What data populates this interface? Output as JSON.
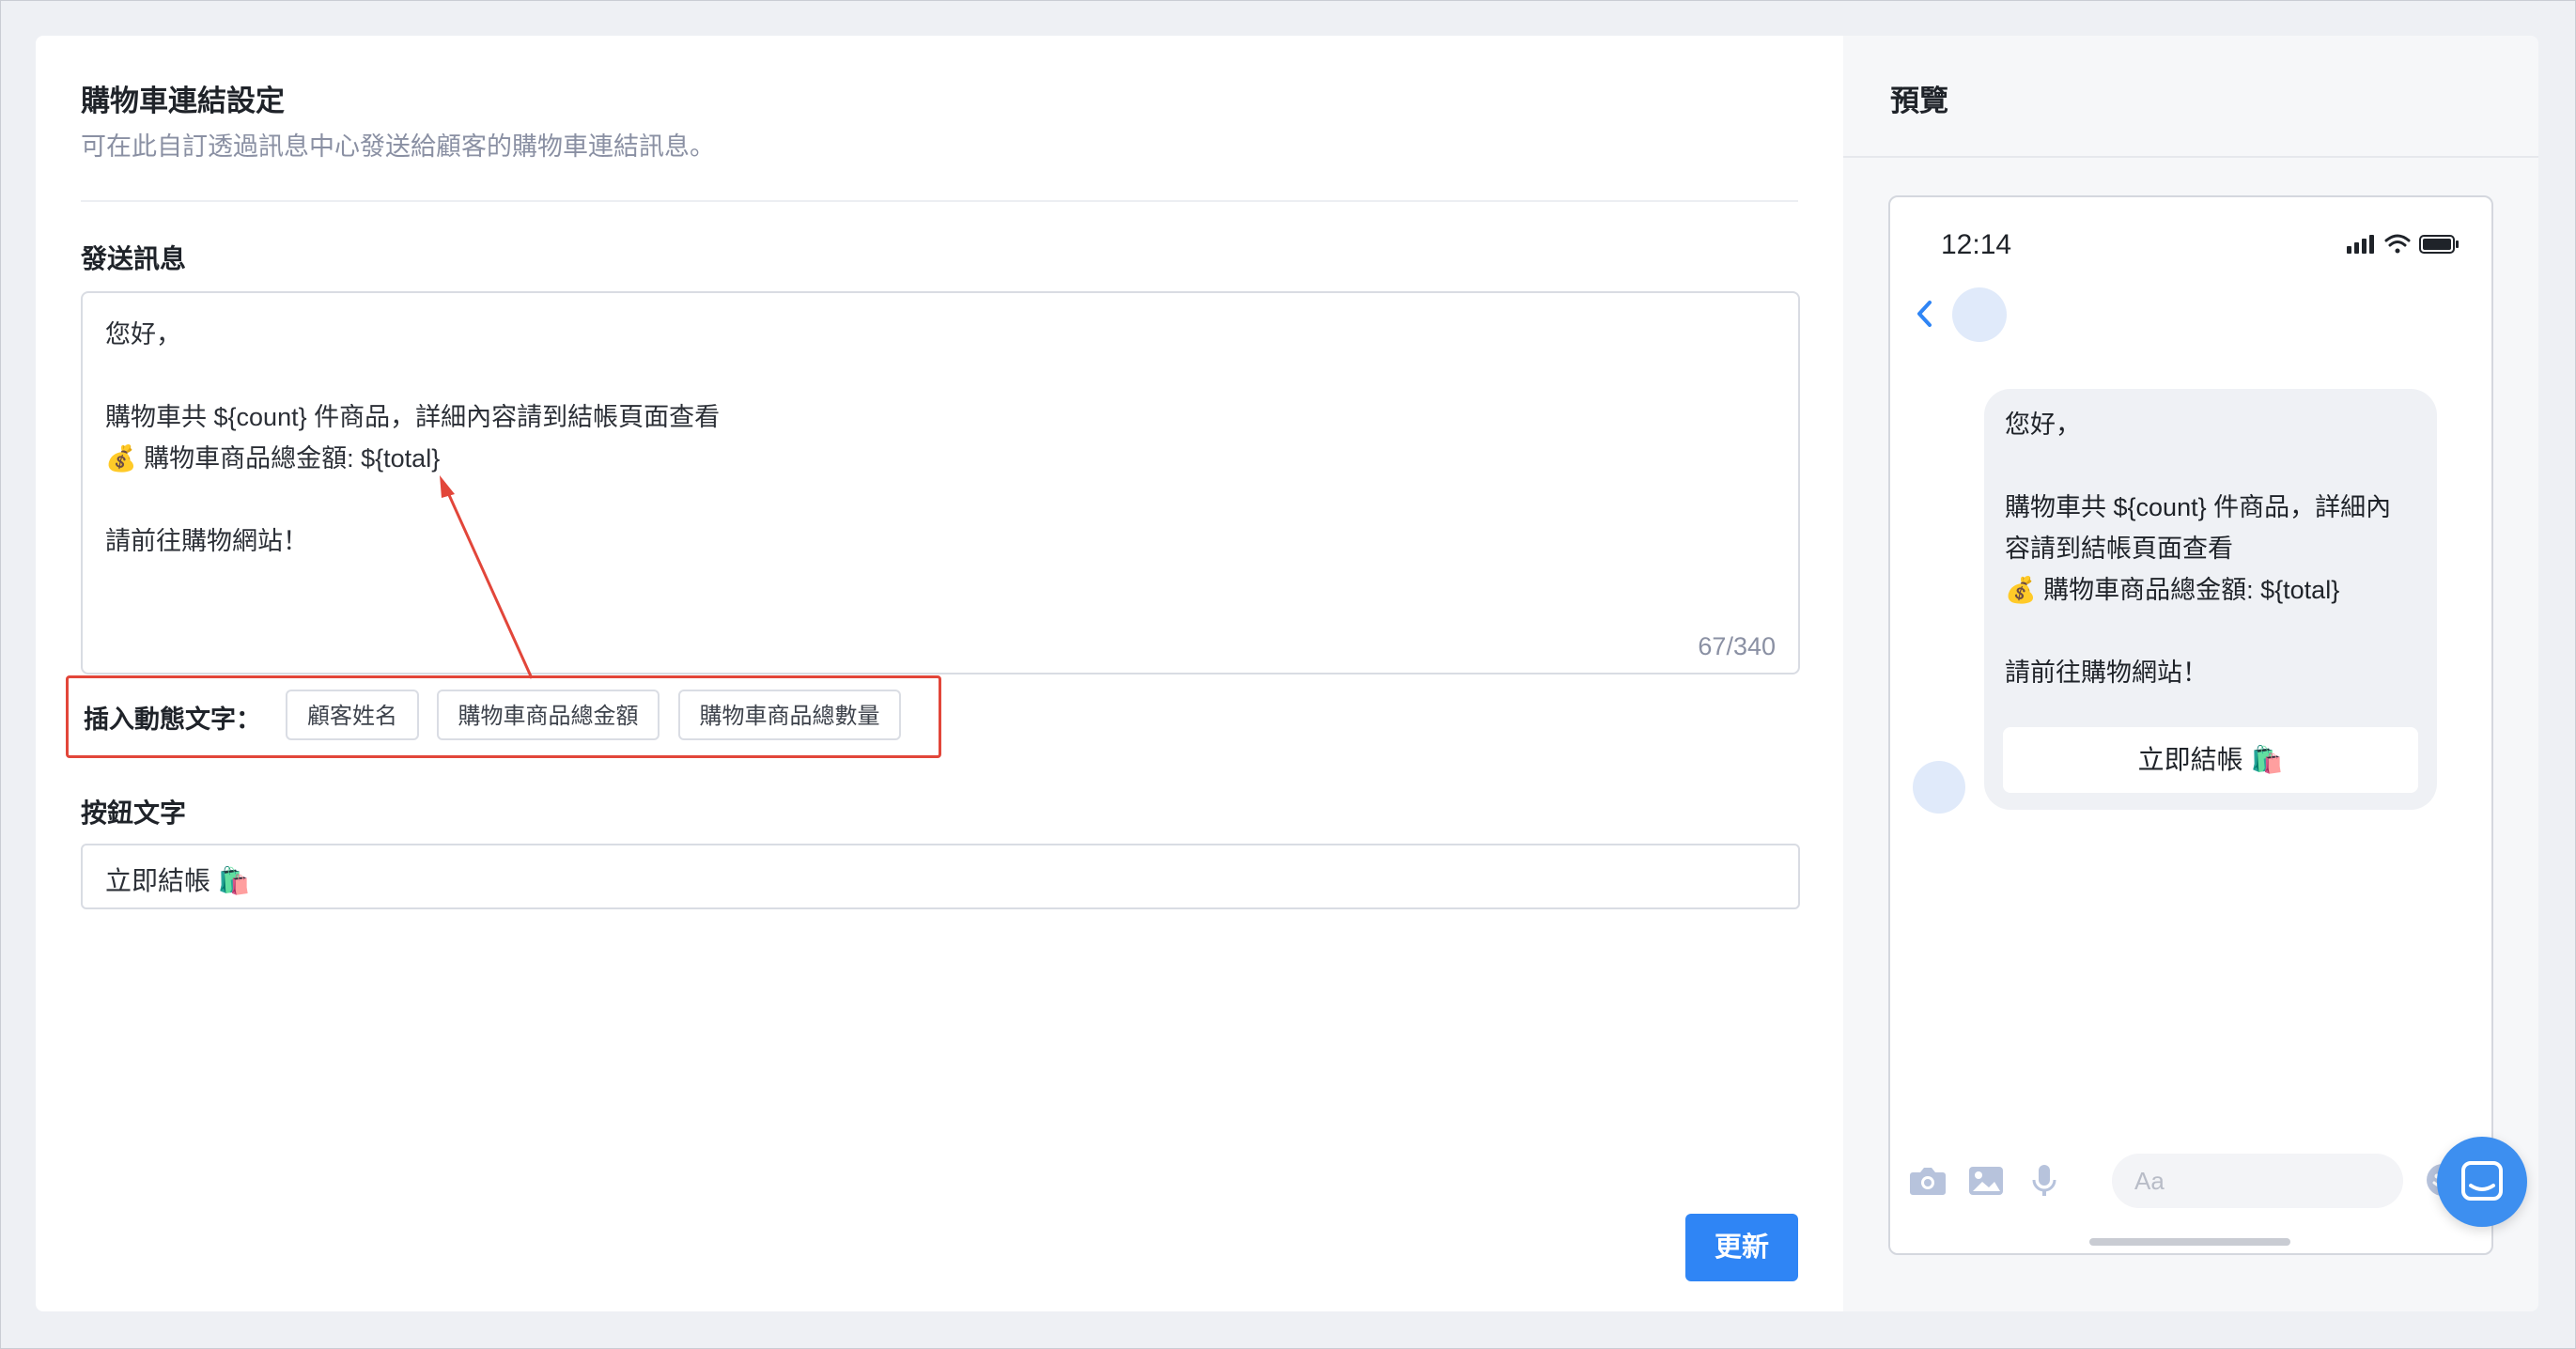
{
  "settings": {
    "title": "購物車連結設定",
    "subtitle": "可在此自訂透過訊息中心發送給顧客的購物車連結訊息。",
    "message_label": "發送訊息",
    "message_lines": [
      "您好，",
      "",
      "購物車共 ${count} 件商品，詳細內容請到結帳頁面查看",
      "💰 購物車商品總金額: ${total}",
      "",
      "請前往購物網站！"
    ],
    "char_counter": "67/340",
    "insert_label": "插入動態文字：",
    "insert_chips": [
      "顧客姓名",
      "購物車商品總金額",
      "購物車商品總數量"
    ],
    "button_text_label": "按鈕文字",
    "button_text_value": "立即結帳 🛍️",
    "update_button": "更新"
  },
  "preview": {
    "title": "預覽",
    "phone_time": "12:14",
    "bubble_lines": [
      "您好，",
      "",
      "購物車共 ${count} 件商品，詳細內",
      "容請到結帳頁面查看",
      "💰 購物車商品總金額: ${total}",
      "",
      "請前往購物網站！"
    ],
    "bubble_button": "立即結帳 🛍️",
    "compose_placeholder": "Aa"
  },
  "colors": {
    "accent": "#2f85f5",
    "annotation": "#e2463a",
    "avatar": "#e0eafa"
  },
  "icons": [
    "back-chevron-icon",
    "camera-icon",
    "image-icon",
    "microphone-icon",
    "emoji-icon",
    "chat-bubble-icon",
    "signal-icon",
    "wifi-icon",
    "battery-icon"
  ]
}
